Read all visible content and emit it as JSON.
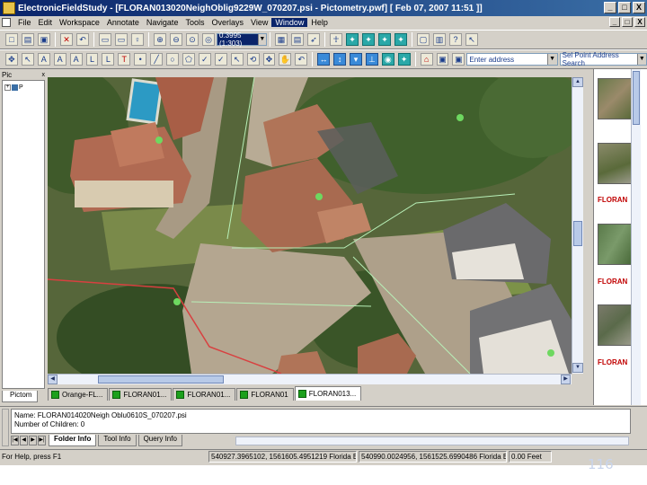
{
  "window": {
    "title": "ElectronicFieldStudy - [FLORAN013020NeighOblig9229W_070207.psi - Pictometry.pwf]  [ Feb 07, 2007 11:51 ]]",
    "minimize": "_",
    "maximize": "□",
    "close": "X"
  },
  "menu": [
    "File",
    "Edit",
    "Workspace",
    "Annotate",
    "Navigate",
    "Tools",
    "Overlays",
    "View",
    "Window",
    "Help"
  ],
  "menu_active": "Window",
  "toolbar1": {
    "scale_value": "0.3995 (1:303)",
    "buttons": [
      "new-icon",
      "open-icon",
      "save-icon",
      "delete-icon",
      "undo-icon",
      "window-icon",
      "window2-icon",
      "pin-icon",
      "zoom-in-icon",
      "zoom-out-icon",
      "zoom-box-icon",
      "zoom-extent-icon",
      "layer-icon",
      "table-icon",
      "pointer-icon",
      "walk-icon",
      "nav-north-icon",
      "nav-east-icon",
      "nav-south-icon",
      "nav-west-icon",
      "frame-icon",
      "book-icon",
      "help-icon",
      "cursor-help-icon"
    ]
  },
  "toolbar2": {
    "address_placeholder": "Enter address",
    "search_label": "Sel Point Address Search",
    "buttons": [
      "pan-icon",
      "select-icon",
      "text-icon",
      "text2-icon",
      "text3-icon",
      "label-icon",
      "label2-icon",
      "marker-icon",
      "point-icon",
      "line-icon",
      "circle-icon",
      "polygon-icon",
      "check-icon",
      "check2-icon",
      "pin-select-icon",
      "rotate-icon",
      "move-icon",
      "hand-icon",
      "undo2-icon",
      "redo-icon",
      "measure-icon",
      "measure-height-icon",
      "measure-area-icon",
      "elevation-icon",
      "camera-icon",
      "bearing-icon",
      "house-icon",
      "parcel-icon",
      "parcel2-icon",
      "parcel3-icon",
      "parcel4-icon"
    ]
  },
  "left_panel": {
    "header": "Pic",
    "close": "x",
    "tree_label": "P",
    "tab": "Pictom"
  },
  "map_tabs": [
    "Orange-FL...",
    "FLORAN01...",
    "FLORAN01...",
    "FLORAN01",
    "FLORAN013..."
  ],
  "map_tab_active": 4,
  "right_strip": {
    "labels": [
      "FLORAN",
      "FLORAN",
      "FLORAN"
    ]
  },
  "info": {
    "name_line": "Name: FLORAN014020Neigh Oblu0610S_070207.psi",
    "children_line": "Number of Children: 0",
    "tabs": [
      "Folder Info",
      "Tool Info",
      "Query Info"
    ],
    "active_tab": "Folder Info"
  },
  "status": {
    "help": "For Help, press F1",
    "coord1": "540927.3965102, 1561605.4951219  Florida E",
    "coord2": "540990.0024956, 1561525.6990486  Florida E",
    "distance": "0.00 Feet"
  },
  "page_number": "116"
}
